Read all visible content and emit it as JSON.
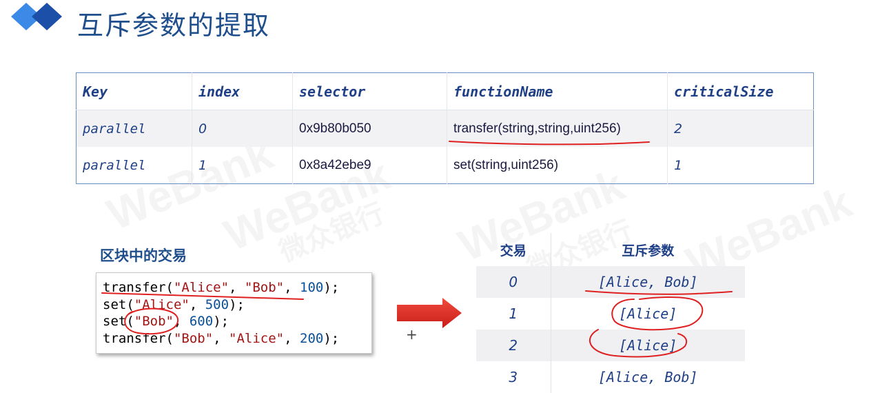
{
  "slide": {
    "title": "互斥参数的提取"
  },
  "watermark": {
    "brand": "WeBank",
    "cn": "微众银行"
  },
  "key_table": {
    "headers": [
      "Key",
      "index",
      "selector",
      "functionName",
      "criticalSize"
    ],
    "rows": [
      [
        "parallel",
        "0",
        "0x9b80b050",
        "transfer(string,string,uint256)",
        "2"
      ],
      [
        "parallel",
        "1",
        "0x8a42ebe9",
        "set(string,uint256)",
        "1"
      ]
    ]
  },
  "code_section": {
    "label": "区块中的交易",
    "lines": [
      {
        "fn": "transfer(",
        "a1": "\"Alice\"",
        "sep1": ", ",
        "a2": "\"Bob\"",
        "sep2": ", ",
        "a3": "100",
        "end": ");"
      },
      {
        "fn": "set(",
        "a1": "\"Alice\"",
        "sep1": ", ",
        "a2": "500",
        "end": ");"
      },
      {
        "fn": "set(",
        "a1": "\"Bob\"",
        "sep1": ", ",
        "a2": "600",
        "end": ");"
      },
      {
        "fn": "transfer(",
        "a1": "\"Bob\"",
        "sep1": ", ",
        "a2": "\"Alice\"",
        "sep2": ", ",
        "a3": "200",
        "end": ");"
      }
    ]
  },
  "result_table": {
    "headers": [
      "交易",
      "互斥参数"
    ],
    "rows": [
      [
        "0",
        "[Alice, Bob]"
      ],
      [
        "1",
        "[Alice]"
      ],
      [
        "2",
        "[Alice]"
      ],
      [
        "3",
        "[Alice, Bob]"
      ]
    ]
  },
  "misc": {
    "plus": "+"
  },
  "colors": {
    "title": "#1f4e8c",
    "accent": "#2a75d6",
    "arrow": "#e0302a",
    "annotation": "#e02020",
    "table_border": "#6a8ec4"
  }
}
